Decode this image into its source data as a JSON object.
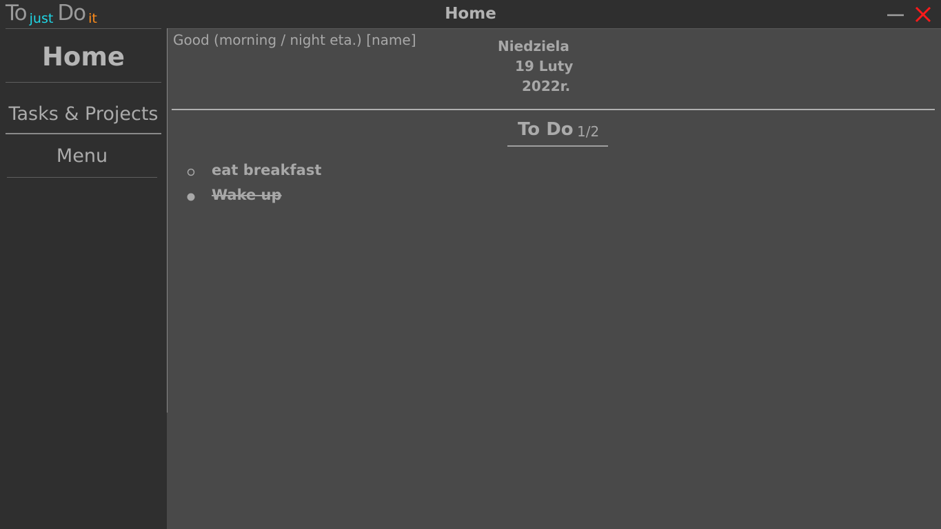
{
  "app": {
    "logo": {
      "part1": "To",
      "part2": "just",
      "part3": "Do",
      "part4": "it",
      "color_part2": "#1fd8e8",
      "color_part4": "#ff8c1a"
    },
    "window_title": "Home",
    "close_color": "#ff1a1a"
  },
  "sidebar": {
    "items": [
      {
        "label": "Home",
        "active": true
      },
      {
        "label": "Tasks & Projects",
        "active": false
      },
      {
        "label": "Menu",
        "active": false
      }
    ]
  },
  "main": {
    "greeting": "Good (morning / night eta.) [name]",
    "date": {
      "weekday": "Niedziela",
      "day_month": "19 Luty",
      "year": "2022r."
    },
    "todo": {
      "title": "To Do",
      "count": "1/2",
      "items": [
        {
          "text": "eat breakfast",
          "done": false
        },
        {
          "text": "Wake up",
          "done": true
        }
      ]
    }
  }
}
